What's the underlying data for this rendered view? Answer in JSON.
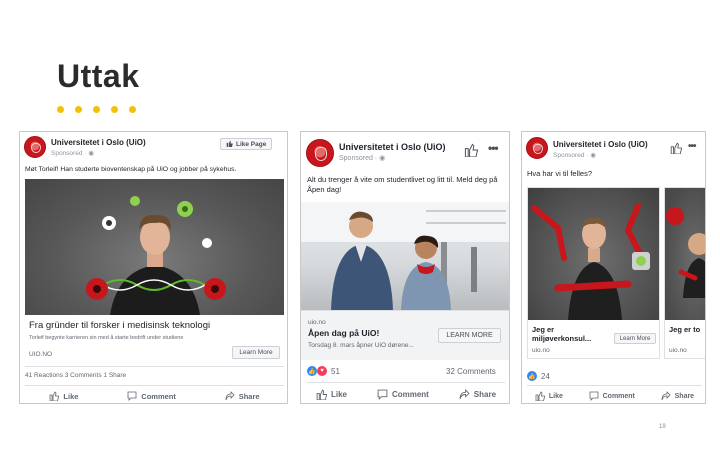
{
  "slide": {
    "title": "Uttak",
    "page_number": "19"
  },
  "ad1": {
    "page_name": "Universitetet i Oslo (UiO)",
    "sponsored": "Sponsored · ",
    "like_page_label": "Like Page",
    "text": "Møt Torleif! Han studerte bioventenskap på UiO og jobber på sykehus.",
    "headline": "Fra gründer til forsker i medisinsk teknologi",
    "description": "Torleif begynte karrieren sin med å starte bedrift under studiene",
    "domain": "UIO.NO",
    "cta_label": "Learn More",
    "stats_text": "41 Reactions  3 Comments  1 Share",
    "actions": {
      "like": "Like",
      "comment": "Comment",
      "share": "Share"
    }
  },
  "ad2": {
    "page_name": "Universitetet i Oslo (UiO)",
    "sponsored": "Sponsored · ",
    "text": "Alt du trenger å vite om studentlivet og litt til. Meld deg på Åpen dag!",
    "domain": "uio.no",
    "headline": "Åpen dag på UiO!",
    "description": "Torsdag 8. mars åpner UiO dørene...",
    "cta_label": "LEARN MORE",
    "reactions_count": "51",
    "comments": "32 Comments",
    "actions": {
      "like": "Like",
      "comment": "Comment",
      "share": "Share"
    }
  },
  "ad3": {
    "page_name": "Universitetet i Oslo (UiO)",
    "sponsored": "Sponsored · ",
    "text": "Hva har vi til felles?",
    "cards": [
      {
        "title": "Jeg er miljøverkonsul...",
        "domain": "uio.no",
        "cta_label": "Learn More"
      },
      {
        "title": "Jeg er to",
        "domain": "uio.no"
      }
    ],
    "reactions_count": "24",
    "actions": {
      "like": "Like",
      "comment": "Comment",
      "share": "Share"
    }
  },
  "colors": {
    "accent_dot": "#f2c200",
    "uio_red": "#c8161d",
    "fb_blue": "#2d88ff"
  }
}
